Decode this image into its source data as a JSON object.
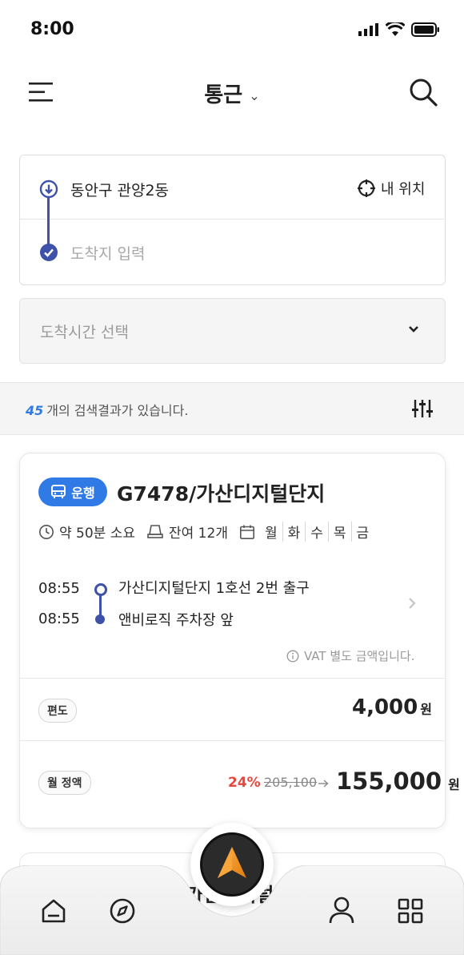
{
  "status_bar": {
    "time": "8:00"
  },
  "header": {
    "title": "통근",
    "title_chevron": "⌄"
  },
  "route": {
    "origin": "동안구 관양2동",
    "destination_placeholder": "도착지 입력",
    "my_location_label": "내 위치"
  },
  "arrival": {
    "placeholder": "도착시간 선택"
  },
  "results": {
    "count": "45",
    "suffix": "개의 검색결과가 있습니다."
  },
  "bus_card": {
    "badge": "운행",
    "route_name": "G7478/가산디지털단지",
    "duration": "약 50분 소요",
    "seats": "잔여 12개",
    "days": [
      "월",
      "화",
      "수",
      "목",
      "금"
    ],
    "stops": [
      {
        "time": "08:55",
        "name": "가산디지털단지 1호선 2번 출구"
      },
      {
        "time": "08:55",
        "name": "앤비로직 주차장 앞"
      }
    ],
    "vat_note": "VAT 별도 금액입니다.",
    "oneway_label": "편도",
    "oneway_price": "4,000",
    "currency": "원",
    "monthly_label": "월 정액",
    "discount": "24%",
    "original_price": "205,100",
    "monthly_price": "155,000"
  },
  "next_card": {
    "title_partial": "가산디지털"
  },
  "colors": {
    "accent": "#2f7ae5",
    "route_line": "#3d52a8",
    "discount": "#e8453c"
  }
}
